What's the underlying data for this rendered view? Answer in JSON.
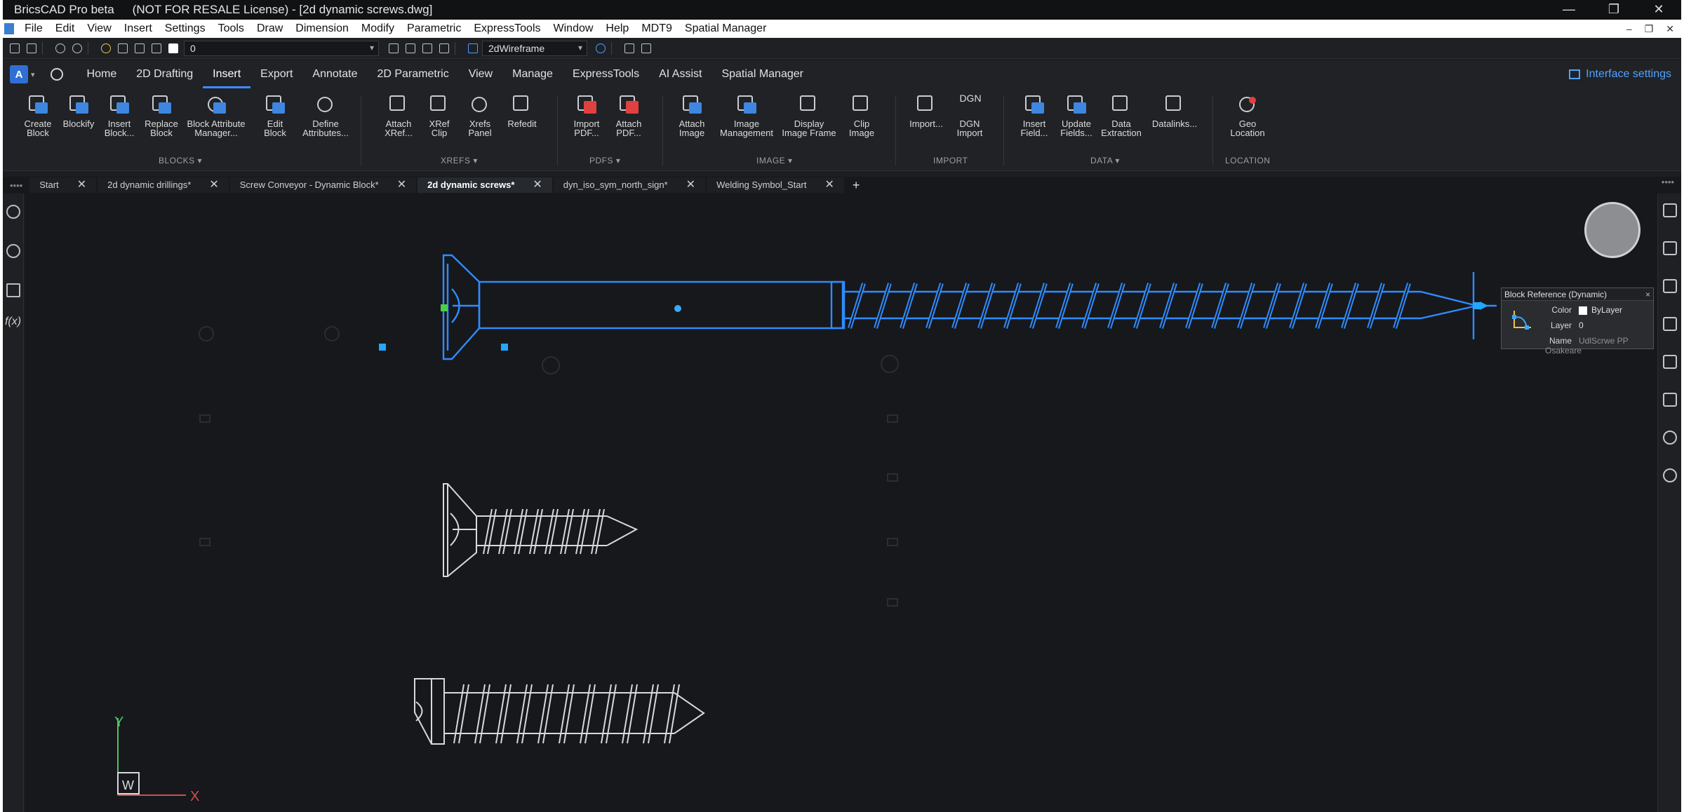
{
  "window": {
    "app_name": "BricsCAD Pro beta",
    "title": "(NOT FOR RESALE License) - [2d dynamic screws.dwg]",
    "minimize": "—",
    "restore": "❐",
    "close": "✕"
  },
  "menubar": {
    "items": [
      "File",
      "Edit",
      "View",
      "Insert",
      "Settings",
      "Tools",
      "Draw",
      "Dimension",
      "Modify",
      "Parametric",
      "ExpressTools",
      "Window",
      "Help",
      "MDT9",
      "Spatial Manager"
    ],
    "controls": [
      "–",
      "❐",
      "✕"
    ]
  },
  "quick_access": {
    "layer_value": "0",
    "visual_style": "2dWireframe"
  },
  "ribbon_tabs": {
    "items": [
      "Home",
      "2D Drafting",
      "Insert",
      "Export",
      "Annotate",
      "2D Parametric",
      "View",
      "Manage",
      "ExpressTools",
      "AI Assist",
      "Spatial Manager"
    ],
    "active": "Insert",
    "interface_settings": "Interface settings"
  },
  "ribbon": {
    "buttons": [
      {
        "l1": "Create",
        "l2": "Block"
      },
      {
        "l1": "Blockify",
        "l2": ""
      },
      {
        "l1": "Insert",
        "l2": "Block..."
      },
      {
        "l1": "Replace",
        "l2": "Block"
      },
      {
        "l1": "Block Attribute",
        "l2": "Manager..."
      },
      {
        "l1": "Edit",
        "l2": "Block"
      },
      {
        "l1": "Define",
        "l2": "Attributes..."
      },
      {
        "l1": "Attach",
        "l2": "XRef..."
      },
      {
        "l1": "XRef",
        "l2": "Clip"
      },
      {
        "l1": "Xrefs",
        "l2": "Panel"
      },
      {
        "l1": "Refedit",
        "l2": ""
      },
      {
        "l1": "Import",
        "l2": "PDF..."
      },
      {
        "l1": "Attach",
        "l2": "PDF..."
      },
      {
        "l1": "Attach",
        "l2": "Image"
      },
      {
        "l1": "Image",
        "l2": "Management"
      },
      {
        "l1": "Display",
        "l2": "Image Frame"
      },
      {
        "l1": "Clip",
        "l2": "Image"
      },
      {
        "l1": "Import...",
        "l2": ""
      },
      {
        "l1": "DGN",
        "l2": "Import"
      },
      {
        "l1": "Insert",
        "l2": "Field..."
      },
      {
        "l1": "Update",
        "l2": "Fields..."
      },
      {
        "l1": "Data",
        "l2": "Extraction"
      },
      {
        "l1": "Datalinks...",
        "l2": ""
      },
      {
        "l1": "Geo",
        "l2": "Location"
      }
    ],
    "dgn_icon_text": "DGN",
    "groups": [
      "BLOCKS",
      "XREFS",
      "PDFS",
      "IMAGE",
      "IMPORT",
      "DATA",
      "LOCATION"
    ]
  },
  "doc_tabs": {
    "items": [
      "Start",
      "2d dynamic drillings*",
      "Screw Conveyor - Dynamic Block*",
      "2d dynamic screws*",
      "dyn_iso_sym_north_sign*",
      "Welding Symbol_Start"
    ],
    "active": "2d dynamic screws*",
    "close_glyph": "✕",
    "add_glyph": "+",
    "overflow": "••••"
  },
  "left_rail": {
    "fx_label": "f(x)"
  },
  "properties_popup": {
    "title": "Block Reference (Dynamic)",
    "close_glyph": "×",
    "color_label": "Color",
    "color_value": "ByLayer",
    "layer_label": "Layer",
    "layer_value": "0",
    "name_label": "Name",
    "name_value": "UdlScrwe PP Osakeare"
  },
  "ucs": {
    "x_label": "X",
    "y_label": "Y",
    "w_label": "W"
  },
  "colors": {
    "selection_blue": "#2f8cff",
    "canvas_bg": "#16181c",
    "entity_white": "#e8e8e8",
    "accent": "#3d8cff"
  }
}
